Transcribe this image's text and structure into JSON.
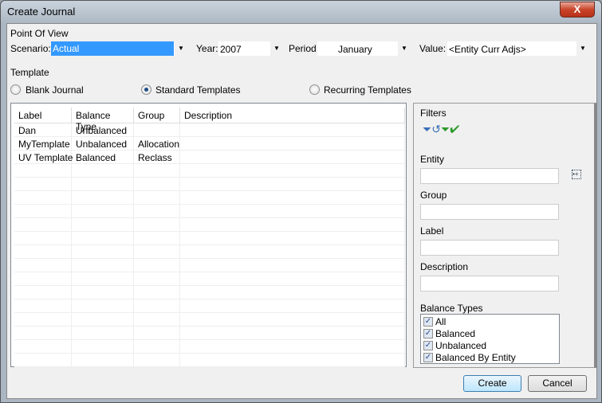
{
  "window": {
    "title": "Create Journal",
    "close": "X"
  },
  "pov": {
    "label": "Point Of View",
    "scenario": {
      "label": "Scenario:",
      "value": "Actual"
    },
    "year": {
      "label": "Year:",
      "value": "2007"
    },
    "period": {
      "label": "Period:",
      "value": "January"
    },
    "value": {
      "label": "Value:",
      "value": "<Entity Curr Adjs>"
    }
  },
  "template": {
    "label": "Template",
    "options": [
      {
        "label": "Blank Journal",
        "selected": false
      },
      {
        "label": "Standard Templates",
        "selected": true
      },
      {
        "label": "Recurring Templates",
        "selected": false
      }
    ]
  },
  "table": {
    "columns": [
      "Label",
      "Balance Type",
      "Group",
      "Description"
    ],
    "rows": [
      [
        "Dan",
        "Unbalanced",
        "",
        ""
      ],
      [
        "MyTemplate",
        "Unbalanced",
        "Allocation",
        ""
      ],
      [
        "UV Template",
        "Balanced",
        "Reclass",
        ""
      ]
    ]
  },
  "filters": {
    "title": "Filters",
    "entity": "Entity",
    "group": "Group",
    "label": "Label",
    "description": "Description",
    "balance_types": "Balance Types",
    "balance_options": [
      {
        "label": "All",
        "checked": true
      },
      {
        "label": "Balanced",
        "checked": true
      },
      {
        "label": "Unbalanced",
        "checked": true
      },
      {
        "label": "Balanced By Entity",
        "checked": true
      }
    ]
  },
  "buttons": {
    "create": "Create",
    "cancel": "Cancel"
  }
}
